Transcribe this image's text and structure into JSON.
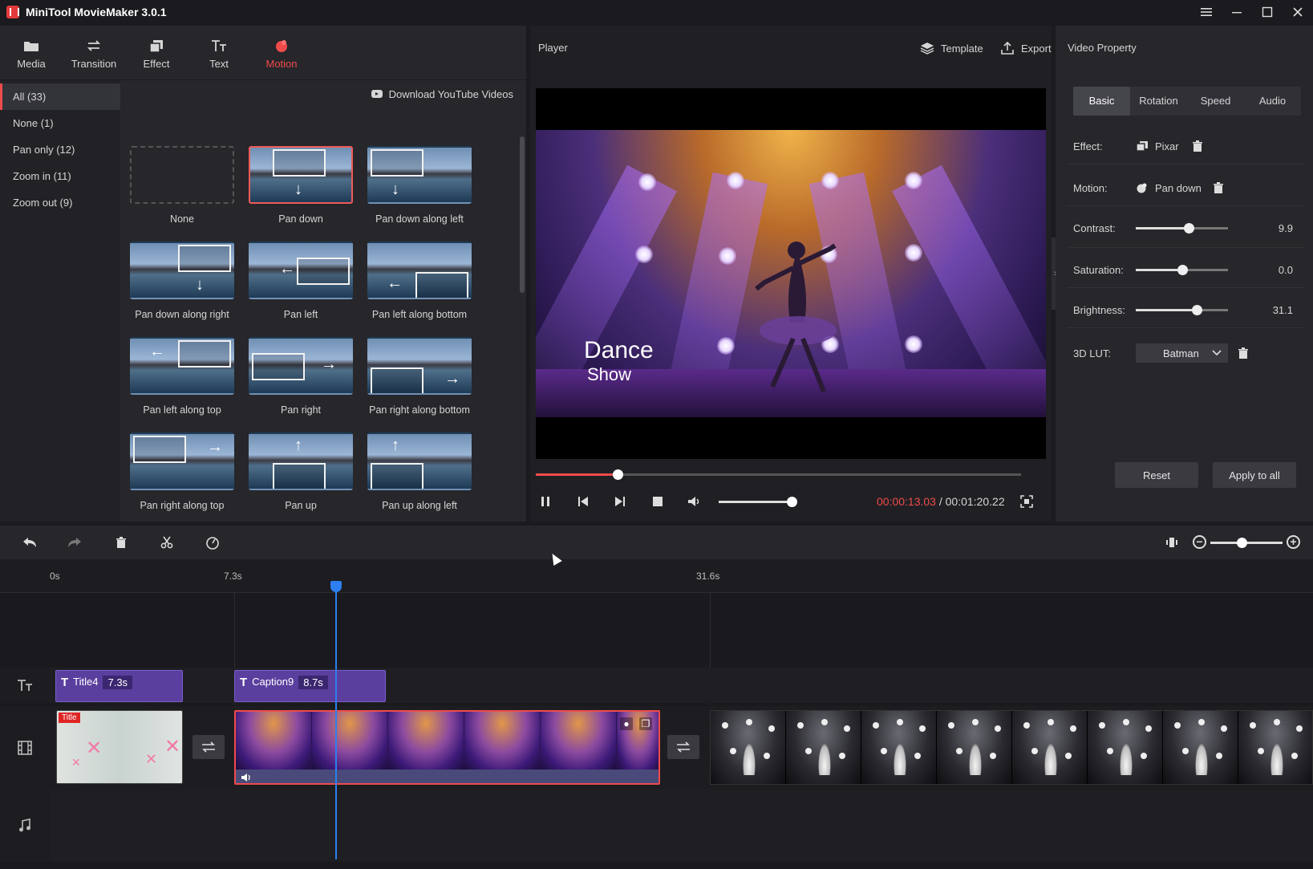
{
  "app": {
    "title": "MiniTool MovieMaker 3.0.1",
    "logo_icon": "moviemaker-logo-icon"
  },
  "window_controls": [
    "menu-icon",
    "minimize-icon",
    "maximize-icon",
    "close-icon"
  ],
  "toolbar": [
    {
      "label": "Media",
      "icon": "media-folder-icon",
      "active": false
    },
    {
      "label": "Transition",
      "icon": "transition-icon",
      "active": false
    },
    {
      "label": "Effect",
      "icon": "effect-icon",
      "active": false
    },
    {
      "label": "Text",
      "icon": "text-icon",
      "active": false
    },
    {
      "label": "Motion",
      "icon": "motion-icon",
      "active": true
    }
  ],
  "categories": [
    {
      "label": "All (33)",
      "active": true
    },
    {
      "label": "None (1)",
      "active": false
    },
    {
      "label": "Pan only (12)",
      "active": false
    },
    {
      "label": "Zoom in (11)",
      "active": false
    },
    {
      "label": "Zoom out (9)",
      "active": false
    }
  ],
  "download_label": "Download YouTube Videos",
  "motions": [
    "None",
    "Pan down",
    "Pan down along left",
    "Pan down along right",
    "Pan left",
    "Pan left along bottom",
    "Pan left along top",
    "Pan right",
    "Pan right along bottom",
    "Pan right along top",
    "Pan up",
    "Pan up along left"
  ],
  "selected_motion": "Pan down",
  "player": {
    "title": "Player",
    "template_label": "Template",
    "export_label": "Export",
    "caption_title": "Dance",
    "caption_sub": "Show",
    "current_time": "00:00:13.03",
    "separator": " / ",
    "total_time": "00:01:20.22",
    "progress_fraction": 0.169,
    "volume_fraction": 0.95
  },
  "property": {
    "title": "Video Property",
    "tabs": [
      {
        "label": "Basic",
        "active": true
      },
      {
        "label": "Rotation",
        "active": false
      },
      {
        "label": "Speed",
        "active": false
      },
      {
        "label": "Audio",
        "active": false
      }
    ],
    "effect_label": "Effect:",
    "effect_value": "Pixar",
    "motion_label": "Motion:",
    "motion_value": "Pan down",
    "contrast_label": "Contrast:",
    "contrast_value": "9.9",
    "contrast_fraction": 0.57,
    "saturation_label": "Saturation:",
    "saturation_value": "0.0",
    "saturation_fraction": 0.5,
    "brightness_label": "Brightness:",
    "brightness_value": "31.1",
    "brightness_fraction": 0.66,
    "lut_label": "3D LUT:",
    "lut_value": "Batman",
    "reset_label": "Reset",
    "apply_label": "Apply to all"
  },
  "timeline": {
    "ruler": [
      "0s",
      "7.3s",
      "31.6s"
    ],
    "zoom_fraction": 0.43,
    "text_clips": [
      {
        "name": "Title4",
        "duration": "7.3s"
      },
      {
        "name": "Caption9",
        "duration": "8.7s"
      }
    ],
    "title_clip_tag": "Title"
  },
  "colors": {
    "accent": "#ef4b4b",
    "playhead": "#2d7ff0",
    "text_clip": "#5a3f9e"
  }
}
